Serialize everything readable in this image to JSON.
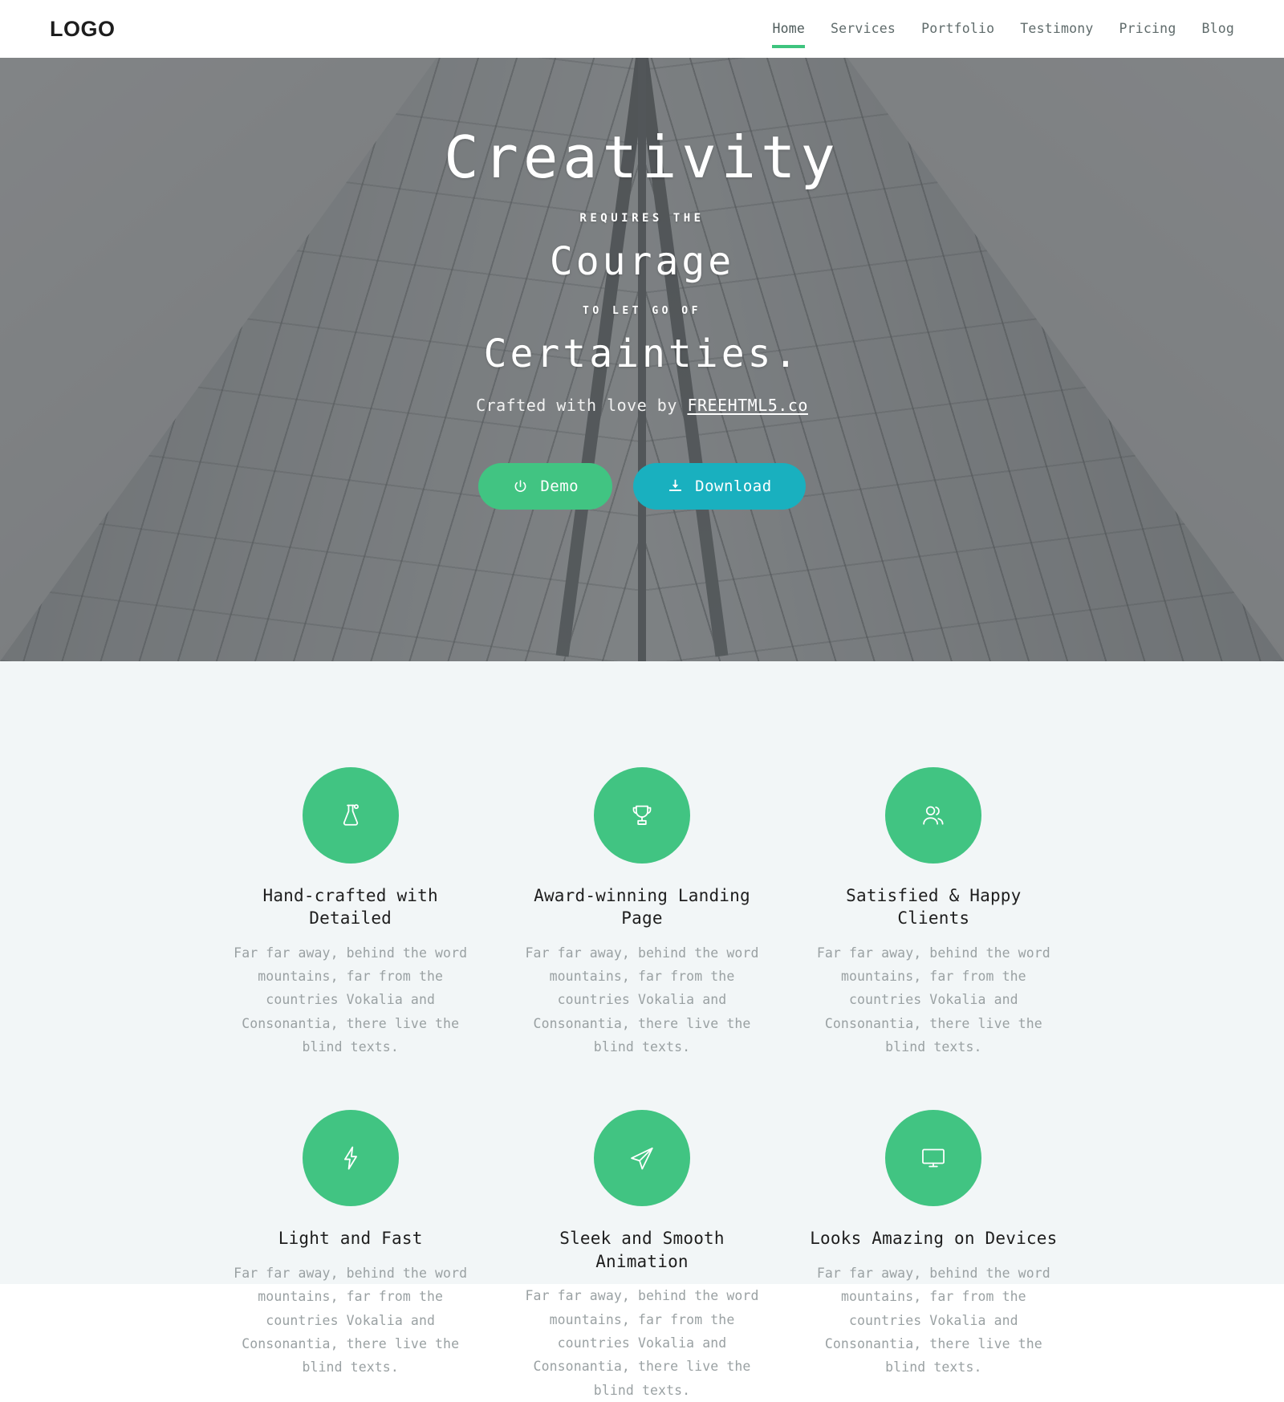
{
  "header": {
    "logo": "LOGO",
    "nav": [
      {
        "label": "Home",
        "active": true
      },
      {
        "label": "Services",
        "active": false
      },
      {
        "label": "Portfolio",
        "active": false
      },
      {
        "label": "Testimony",
        "active": false
      },
      {
        "label": "Pricing",
        "active": false
      },
      {
        "label": "Blog",
        "active": false
      }
    ]
  },
  "hero": {
    "line1": "Creativity",
    "line2": "REQUIRES THE",
    "line3": "Courage",
    "line4": "TO LET GO OF",
    "line5": "Certainties.",
    "credit_prefix": "Crafted with love by ",
    "credit_link": "FREEHTML5.co",
    "buttons": [
      {
        "label": "Demo",
        "icon": "power-icon",
        "color": "#41c482"
      },
      {
        "label": "Download",
        "icon": "download-icon",
        "color": "#19b0bf"
      }
    ]
  },
  "features": {
    "accent_color": "#41c482",
    "background_color": "#f2f6f7",
    "items": [
      {
        "icon": "beaker-icon",
        "title": "Hand-crafted with Detailed",
        "text": "Far far away, behind the word mountains, far from the countries Vokalia and Consonantia, there live the blind texts."
      },
      {
        "icon": "trophy-icon",
        "title": "Award-winning Landing Page",
        "text": "Far far away, behind the word mountains, far from the countries Vokalia and Consonantia, there live the blind texts."
      },
      {
        "icon": "users-icon",
        "title": "Satisfied & Happy Clients",
        "text": "Far far away, behind the word mountains, far from the countries Vokalia and Consonantia, there live the blind texts."
      },
      {
        "icon": "bolt-icon",
        "title": "Light and Fast",
        "text": "Far far away, behind the word mountains, far from the countries Vokalia and Consonantia, there live the blind texts."
      },
      {
        "icon": "paper-plane-icon",
        "title": "Sleek and Smooth Animation",
        "text": "Far far away, behind the word mountains, far from the countries Vokalia and Consonantia, there live the blind texts."
      },
      {
        "icon": "monitor-icon",
        "title": "Looks Amazing on Devices",
        "text": "Far far away, behind the word mountains, far from the countries Vokalia and Consonantia, there live the blind texts."
      }
    ]
  }
}
